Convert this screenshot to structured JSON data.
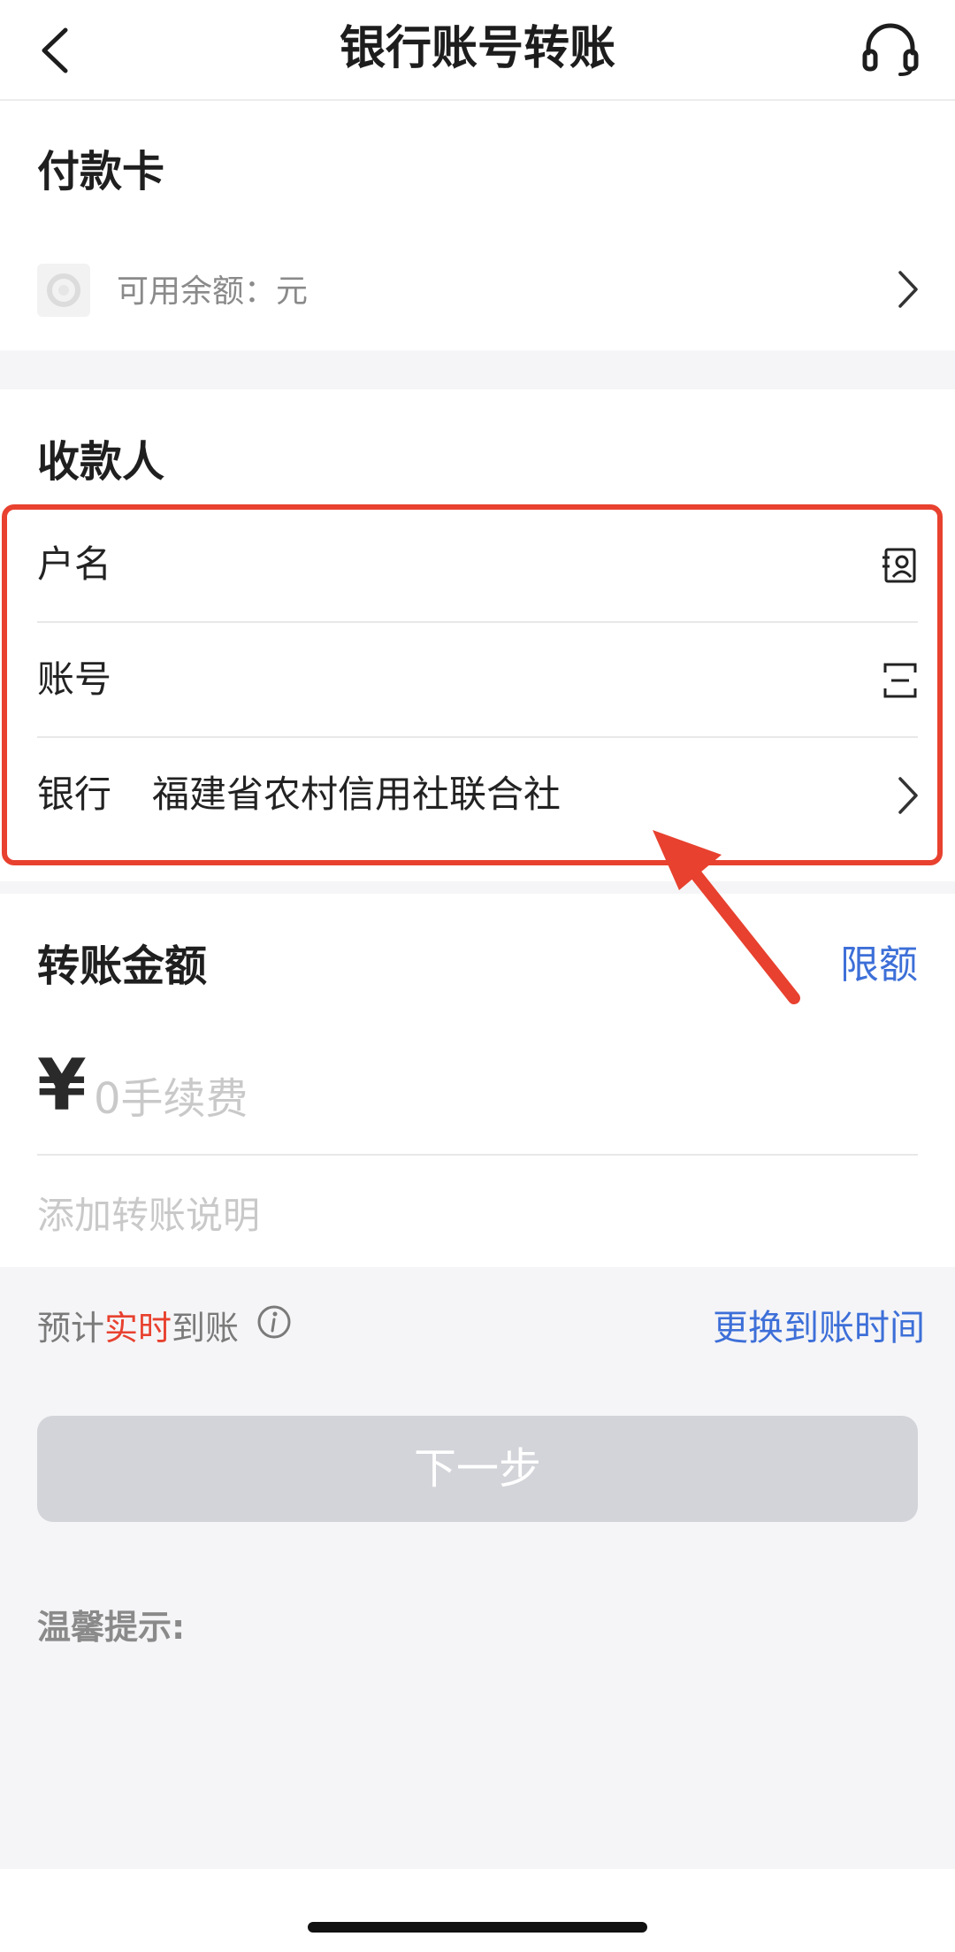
{
  "header": {
    "title": "银行账号转账",
    "back_icon": "chevron-left-icon",
    "service_icon": "headset-icon"
  },
  "payer": {
    "heading": "付款卡",
    "balance_label": "可用余额：元"
  },
  "payee": {
    "heading": "收款人",
    "name_label": "户名",
    "account_label": "账号",
    "bank_label": "银行",
    "bank_value": "福建省农村信用社联合社"
  },
  "amount": {
    "heading": "转账金额",
    "limit_link": "限额",
    "currency": "¥",
    "placeholder": "0手续费",
    "note_placeholder": "添加转账说明"
  },
  "arrival": {
    "prefix": "预计",
    "highlight": "实时",
    "suffix": "到账",
    "change_link": "更换到账时间"
  },
  "next_button": "下一步",
  "tips_heading": "温馨提示:",
  "colors": {
    "accent_blue": "#3d6fd8",
    "highlight_red": "#e8412f",
    "button_disabled": "#d3d4d9"
  }
}
